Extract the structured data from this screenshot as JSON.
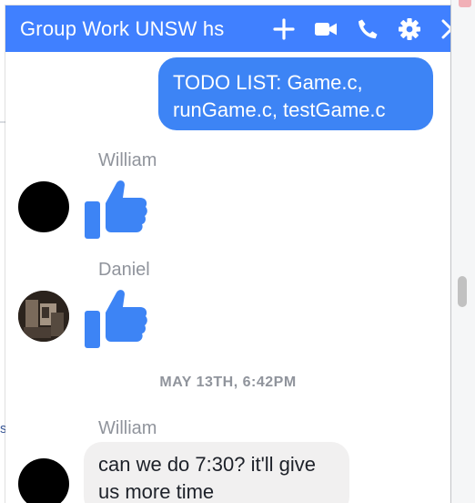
{
  "chat": {
    "title": "Group Work UNSW hs",
    "icons": [
      "plus-icon",
      "video-camera-icon",
      "phone-icon",
      "gear-icon",
      "close-icon"
    ],
    "accent_color": "#4080ff"
  },
  "messages": [
    {
      "type": "outgoing",
      "text_line1": "TODO LIST: Game.c,",
      "text_line2": "runGame.c, testGame.c"
    },
    {
      "type": "like",
      "sender": "William",
      "icon": "thumbs-up-icon"
    },
    {
      "type": "like",
      "sender": "Daniel",
      "icon": "thumbs-up-icon"
    },
    {
      "type": "timestamp",
      "text": "MAY 13TH, 6:42PM"
    },
    {
      "type": "incoming",
      "sender": "William",
      "text_line1": "can we do 7:30? it'll give",
      "text_line2": "us more time"
    }
  ]
}
